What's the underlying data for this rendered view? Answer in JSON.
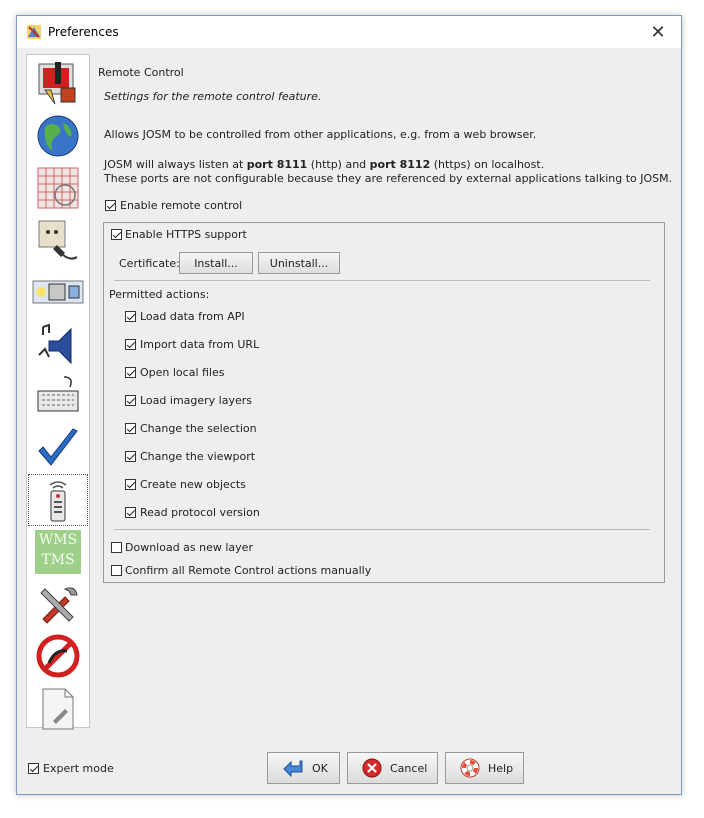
{
  "window": {
    "title": "Preferences"
  },
  "sidebar": {
    "items": [
      {
        "icon": "display-preferences-icon"
      },
      {
        "icon": "globe-connection-icon"
      },
      {
        "icon": "map-grid-projection-icon"
      },
      {
        "icon": "plugin-plug-icon"
      },
      {
        "icon": "toolbar-buttons-icon"
      },
      {
        "icon": "audio-speaker-icon"
      },
      {
        "icon": "keyboard-shortcuts-icon"
      },
      {
        "icon": "validator-checkmark-icon"
      },
      {
        "icon": "remote-control-icon",
        "selected": true
      },
      {
        "icon": "wms-tms-imagery-icon",
        "label1": "WMS",
        "label2": "TMS"
      },
      {
        "icon": "advanced-tools-icon"
      },
      {
        "icon": "no-entry-filter-icon"
      },
      {
        "icon": "advanced-document-icon"
      }
    ]
  },
  "remote": {
    "title": "Remote Control",
    "subtitle": "Settings for the remote control feature.",
    "intro": "Allows JOSM to be controlled from other applications, e.g. from a web browser.",
    "ports_line1_a": "JOSM will always listen at ",
    "ports_port1": "port 8111",
    "ports_line1_b": " (http) and ",
    "ports_port2": "port 8112",
    "ports_line1_c": " (https) on localhost.",
    "ports_line2": "These ports are not configurable because they are referenced by external applications talking to JOSM.",
    "enable_label": "Enable remote control",
    "enable_checked": true,
    "https_label": "Enable HTTPS support",
    "https_checked": true,
    "certificate_label": "Certificate:",
    "install_label": "Install...",
    "uninstall_label": "Uninstall...",
    "permitted_label": "Permitted actions:",
    "actions": [
      {
        "label": "Load data from API",
        "checked": true
      },
      {
        "label": "Import data from URL",
        "checked": true
      },
      {
        "label": "Open local files",
        "checked": true
      },
      {
        "label": "Load imagery layers",
        "checked": true
      },
      {
        "label": "Change the selection",
        "checked": true
      },
      {
        "label": "Change the viewport",
        "checked": true
      },
      {
        "label": "Create new objects",
        "checked": true
      },
      {
        "label": "Read protocol version",
        "checked": true
      }
    ],
    "download_new_layer_label": "Download as new layer",
    "download_new_layer_checked": false,
    "confirm_label": "Confirm all Remote Control actions manually",
    "confirm_checked": false
  },
  "footer": {
    "expert_label": "Expert mode",
    "expert_checked": true,
    "ok_label": "OK",
    "cancel_label": "Cancel",
    "help_label": "Help"
  }
}
